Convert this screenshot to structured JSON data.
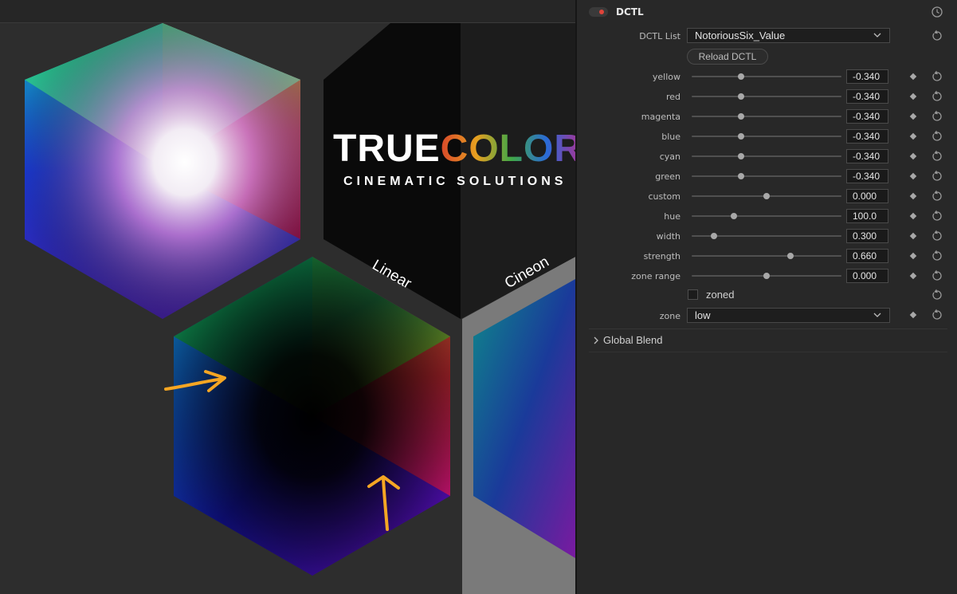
{
  "panel": {
    "title": "DCTL",
    "dctl_list_label": "DCTL List",
    "dctl_list_value": "NotoriousSix_Value",
    "reload_label": "Reload DCTL",
    "sliders": [
      {
        "label": "yellow",
        "value": "-0.340",
        "position": 0.33
      },
      {
        "label": "red",
        "value": "-0.340",
        "position": 0.33
      },
      {
        "label": "magenta",
        "value": "-0.340",
        "position": 0.33
      },
      {
        "label": "blue",
        "value": "-0.340",
        "position": 0.33
      },
      {
        "label": "cyan",
        "value": "-0.340",
        "position": 0.33
      },
      {
        "label": "green",
        "value": "-0.340",
        "position": 0.33
      },
      {
        "label": "custom",
        "value": "0.000",
        "position": 0.5
      },
      {
        "label": "hue",
        "value": "100.0",
        "position": 0.28
      },
      {
        "label": "width",
        "value": "0.300",
        "position": 0.15
      },
      {
        "label": "strength",
        "value": "0.660",
        "position": 0.66
      },
      {
        "label": "zone range",
        "value": "0.000",
        "position": 0.5
      }
    ],
    "zoned_label": "zoned",
    "zoned_checked": false,
    "zone_label": "zone",
    "zone_value": "low",
    "global_blend_label": "Global Blend"
  },
  "viewer": {
    "logo_true": "TRUE",
    "logo_color": "COLOR",
    "logo_sub": "CINEMATIC SOLUTIONS",
    "label_linear": "Linear",
    "label_cineon": "Cineon"
  },
  "colors": {
    "accent_red": "#e0443a",
    "annotation_orange": "#f5a623"
  }
}
